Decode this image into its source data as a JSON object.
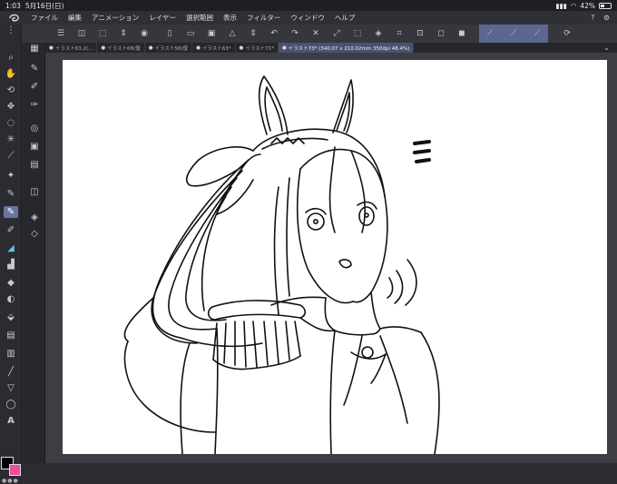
{
  "status": {
    "time": "1:03",
    "date": "5月16日(日)",
    "battery": "42%",
    "battery_level": 0.42
  },
  "menu": {
    "items": [
      "ファイル",
      "編集",
      "アニメーション",
      "レイヤー",
      "選択範囲",
      "表示",
      "フィルター",
      "ウィンドウ",
      "ヘルプ"
    ],
    "right_icons": [
      "help-icon",
      "settings-icon"
    ]
  },
  "tabs": [
    {
      "label": "イラスト63.2(...",
      "active": false
    },
    {
      "label": "イラスト68(復",
      "active": false
    },
    {
      "label": "イラスト58(復",
      "active": false
    },
    {
      "label": "イラスト63*",
      "active": false
    },
    {
      "label": "イラスト71*",
      "active": false
    },
    {
      "label": "イラスト73* (340.07 x 210.02mm 350dpi 48.4%)",
      "active": true
    }
  ],
  "colors": {
    "main": "#000000",
    "sub": "#ee4d9a",
    "accent": "#5b6791"
  },
  "tools": [
    "zoom-icon",
    "hand-icon",
    "rotate-icon",
    "move-icon",
    "lasso-icon",
    "magic-wand-icon",
    "eyedropper-icon",
    "pen-icon",
    "pencil-icon",
    "brush-icon",
    "airbrush-icon",
    "decoration-icon",
    "eraser-icon",
    "blend-icon",
    "fill-icon",
    "gradient-icon",
    "figure-icon",
    "frame-icon",
    "line-icon",
    "balloon-icon",
    "text-icon"
  ]
}
